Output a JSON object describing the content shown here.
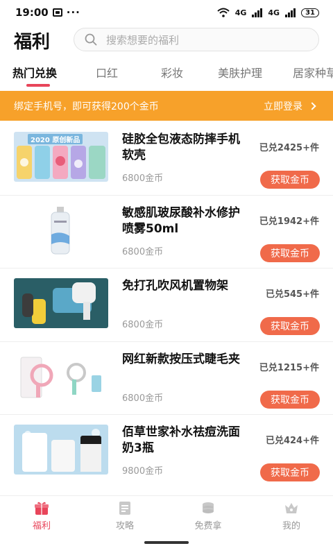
{
  "status_bar": {
    "time": "19:00",
    "dots": "···",
    "network1": "4G",
    "network2": "4G",
    "battery": "31"
  },
  "header": {
    "title": "福利",
    "search_placeholder": "搜索想要的福利"
  },
  "tabs": [
    {
      "label": "热门兑换",
      "active": true
    },
    {
      "label": "口红",
      "active": false
    },
    {
      "label": "彩妆",
      "active": false
    },
    {
      "label": "美肤护理",
      "active": false
    },
    {
      "label": "居家种草",
      "active": false
    }
  ],
  "banner": {
    "text": "绑定手机号，即可获得200个金币",
    "action": "立即登录"
  },
  "products": [
    {
      "title": "硅胶全包液态防摔手机软壳",
      "price": "6800金币",
      "sold": "已兑2425+件",
      "button": "获取金币",
      "thumb_text": "2020 原创新品"
    },
    {
      "title": "敏感肌玻尿酸补水修护喷雾50ml",
      "price": "6800金币",
      "sold": "已兑1942+件",
      "button": "获取金币"
    },
    {
      "title": "免打孔吹风机置物架",
      "price": "6800金币",
      "sold": "已兑545+件",
      "button": "获取金币"
    },
    {
      "title": "网红新款按压式睫毛夹",
      "price": "6800金币",
      "sold": "已兑1215+件",
      "button": "获取金币"
    },
    {
      "title": "佰草世家补水祛痘洗面奶3瓶",
      "price": "9800金币",
      "sold": "已兑424+件",
      "button": "获取金币"
    }
  ],
  "bottom_nav": [
    {
      "label": "福利",
      "icon": "gift-icon",
      "active": true
    },
    {
      "label": "攻略",
      "icon": "document-icon",
      "active": false
    },
    {
      "label": "免费拿",
      "icon": "coins-icon",
      "active": false
    },
    {
      "label": "我的",
      "icon": "crown-icon",
      "active": false
    }
  ],
  "colors": {
    "accent": "#e8455a",
    "banner": "#f7a12a",
    "button": "#f06a4a"
  }
}
